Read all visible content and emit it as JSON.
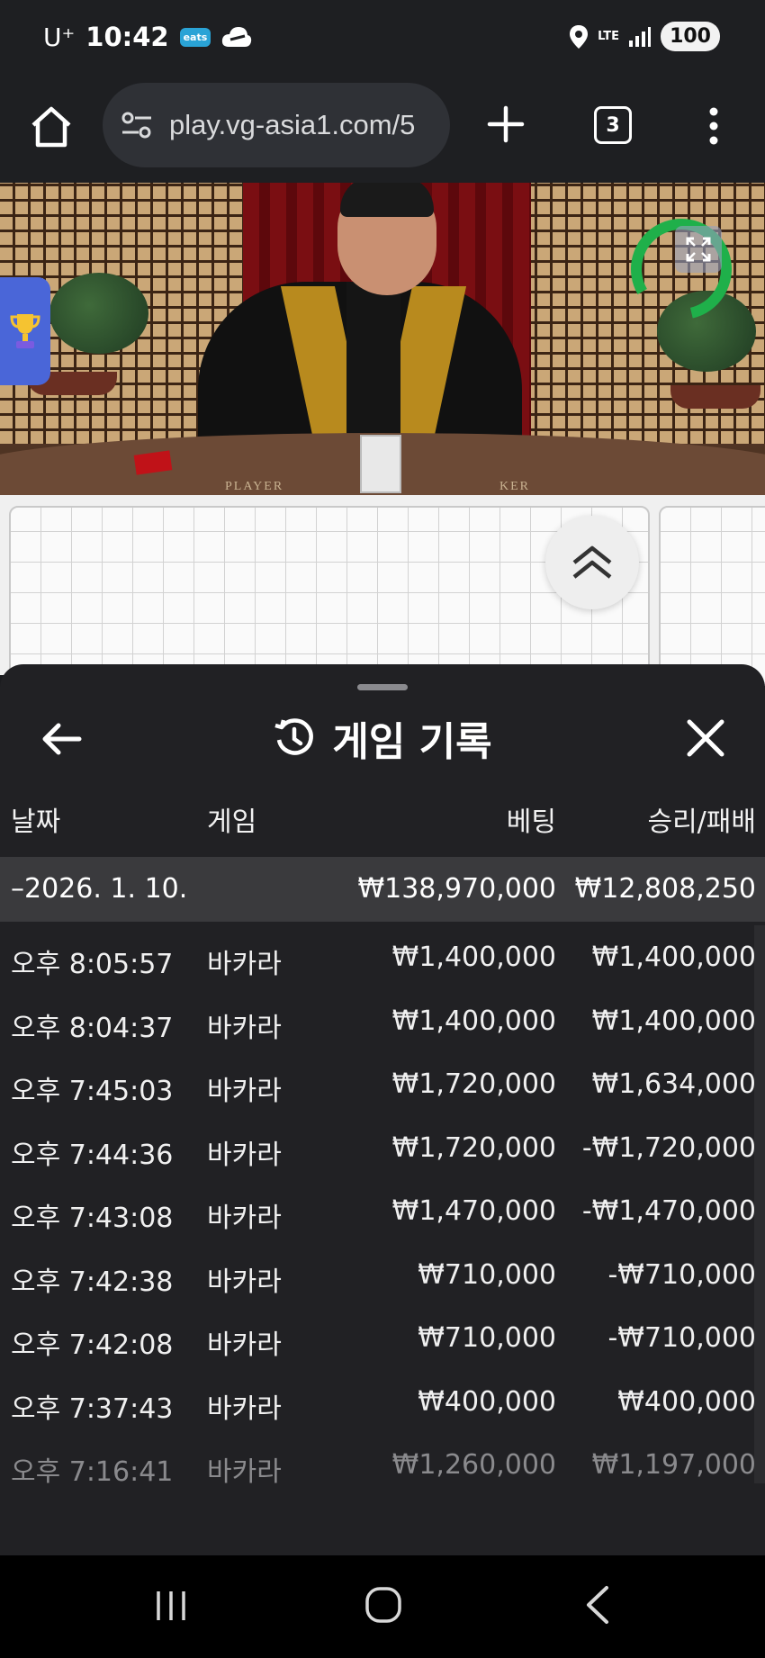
{
  "status_bar": {
    "carrier": "U⁺",
    "time": "10:42",
    "eats_badge": "eats",
    "network": "LTE",
    "battery": "100"
  },
  "browser": {
    "url": "play.vg-asia1.com/5",
    "tab_count": "3"
  },
  "video": {
    "table_label_player": "PLAYER",
    "table_label_banker": "KER"
  },
  "sheet": {
    "title": "게임 기록",
    "columns": {
      "date": "날짜",
      "game": "게임",
      "bet": "베팅",
      "result": "승리/패배"
    },
    "summary": {
      "date": "–2026. 1. 10.",
      "bet": "₩138,970,000",
      "result": "₩12,808,250"
    },
    "rows": [
      {
        "time": "오후 8:05:57",
        "game": "바카라",
        "bet": "₩1,400,000",
        "result": "₩1,400,000"
      },
      {
        "time": "오후 8:04:37",
        "game": "바카라",
        "bet": "₩1,400,000",
        "result": "₩1,400,000"
      },
      {
        "time": "오후 7:45:03",
        "game": "바카라",
        "bet": "₩1,720,000",
        "result": "₩1,634,000"
      },
      {
        "time": "오후 7:44:36",
        "game": "바카라",
        "bet": "₩1,720,000",
        "result": "-₩1,720,000"
      },
      {
        "time": "오후 7:43:08",
        "game": "바카라",
        "bet": "₩1,470,000",
        "result": "-₩1,470,000"
      },
      {
        "time": "오후 7:42:38",
        "game": "바카라",
        "bet": "₩710,000",
        "result": "-₩710,000"
      },
      {
        "time": "오후 7:42:08",
        "game": "바카라",
        "bet": "₩710,000",
        "result": "-₩710,000"
      },
      {
        "time": "오후 7:37:43",
        "game": "바카라",
        "bet": "₩400,000",
        "result": "₩400,000"
      },
      {
        "time": "오후 7:16:41",
        "game": "바카라",
        "bet": "₩1,260,000",
        "result": "₩1,197,000"
      }
    ]
  },
  "colors": {
    "sheet_bg": "#212124",
    "summary_bg": "#3a3a3d",
    "accent_green": "#1fb04a",
    "trophy_panel": "#4a66d8"
  },
  "icons": [
    "home-icon",
    "tune-icon",
    "plus-icon",
    "tab-switcher-icon",
    "more-vert-icon",
    "trophy-icon",
    "expand-icon",
    "chevron-up-double-icon",
    "back-arrow-icon",
    "history-icon",
    "close-icon",
    "nav-recents-icon",
    "nav-home-icon",
    "nav-back-icon"
  ]
}
